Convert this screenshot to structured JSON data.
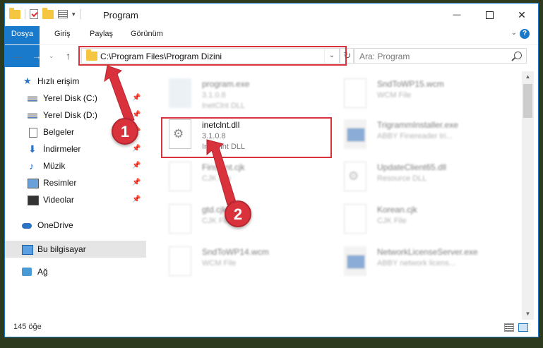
{
  "window": {
    "title": "Program",
    "minimize_glyph": "—",
    "close_glyph": "✕"
  },
  "ribbon": {
    "tabs": [
      "Dosya",
      "Giriş",
      "Paylaş",
      "Görünüm"
    ],
    "help_glyph": "?"
  },
  "nav": {
    "address": "C:\\Program Files\\Program Dizini",
    "search_placeholder": "Ara: Program"
  },
  "sidebar": {
    "items": [
      {
        "label": "Hızlı erişim",
        "icon": "star-icon",
        "pinned": false
      },
      {
        "label": "Yerel Disk (C:)",
        "icon": "drive-icon",
        "pinned": true
      },
      {
        "label": "Yerel Disk (D:)",
        "icon": "drive-icon",
        "pinned": true
      },
      {
        "label": "Belgeler",
        "icon": "document-icon",
        "pinned": true
      },
      {
        "label": "İndirmeler",
        "icon": "download-icon",
        "pinned": true
      },
      {
        "label": "Müzik",
        "icon": "music-icon",
        "pinned": true
      },
      {
        "label": "Resimler",
        "icon": "pictures-icon",
        "pinned": true
      },
      {
        "label": "Videolar",
        "icon": "videos-icon",
        "pinned": true
      },
      {
        "label": "OneDrive",
        "icon": "cloud-icon",
        "pinned": false
      },
      {
        "label": "Bu bilgisayar",
        "icon": "computer-icon",
        "pinned": false,
        "selected": true
      },
      {
        "label": "Ağ",
        "icon": "network-icon",
        "pinned": false
      }
    ]
  },
  "files": [
    {
      "name": "program.exe",
      "version": "3.1.0.8",
      "type": "InetClnt DLL",
      "icon": "exe-icon",
      "blurred": true
    },
    {
      "name": "SndToWP15.wcm",
      "version": "WCM File",
      "type": "",
      "icon": "file-icon",
      "blurred": true
    },
    {
      "name": "inetclnt.dll",
      "version": "3.1.0.8",
      "type": "InetClnt DLL",
      "icon": "dll-gear-icon",
      "blurred": false
    },
    {
      "name": "TrigrammInstaller.exe",
      "version": "ABBY Finereader tri...",
      "type": "",
      "icon": "app-icon",
      "blurred": true
    },
    {
      "name": "Finsmnt.cjk",
      "version": "CJK File",
      "type": "",
      "icon": "file-icon",
      "blurred": true
    },
    {
      "name": "UpdateClient65.dll",
      "version": "Resource DLL",
      "type": "",
      "icon": "dll-gear-icon",
      "blurred": true
    },
    {
      "name": "gtd.cjk",
      "version": "CJK File",
      "type": "",
      "icon": "file-icon",
      "blurred": true
    },
    {
      "name": "Korean.cjk",
      "version": "CJK File",
      "type": "",
      "icon": "file-icon",
      "blurred": true
    },
    {
      "name": "SndToWP14.wcm",
      "version": "WCM File",
      "type": "",
      "icon": "file-icon",
      "blurred": true
    },
    {
      "name": "NetworkLicenseServer.exe",
      "version": "ABBY network licens...",
      "type": "",
      "icon": "app-icon",
      "blurred": true
    }
  ],
  "status": {
    "item_count": "145 öğe"
  },
  "annotations": {
    "step1": "1",
    "step2": "2",
    "color": "#d9323c"
  },
  "colors": {
    "accent": "#1979ca",
    "annotation_red": "#d9323c",
    "folder": "#f4c642"
  }
}
